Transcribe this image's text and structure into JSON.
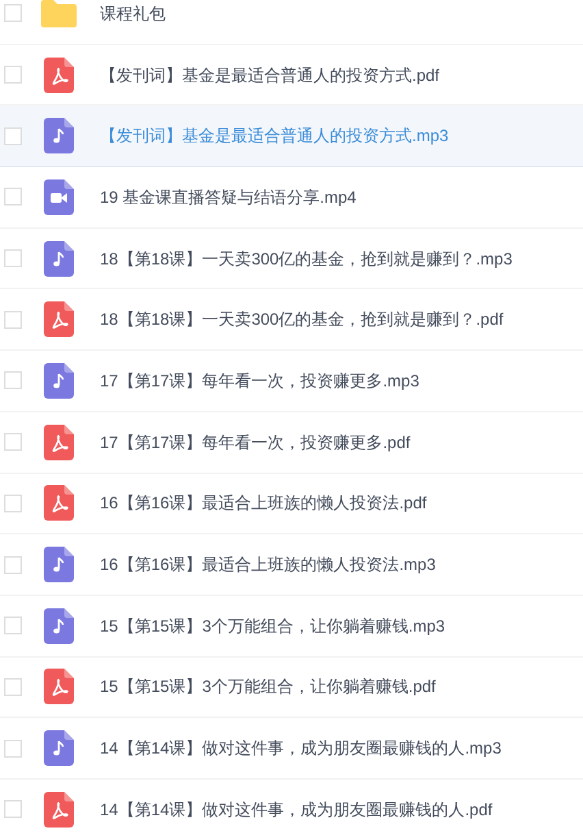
{
  "files": [
    {
      "kind": "folder",
      "name": "课程礼包",
      "selected": false,
      "checked": false
    },
    {
      "kind": "pdf",
      "name": "【发刊词】基金是最适合普通人的投资方式.pdf",
      "selected": false,
      "checked": false
    },
    {
      "kind": "audio",
      "name": "【发刊词】基金是最适合普通人的投资方式.mp3",
      "selected": true,
      "checked": false
    },
    {
      "kind": "video",
      "name": "19 基金课直播答疑与结语分享.mp4",
      "selected": false,
      "checked": false
    },
    {
      "kind": "audio",
      "name": "18【第18课】一天卖300亿的基金，抢到就是赚到？.mp3",
      "selected": false,
      "checked": false
    },
    {
      "kind": "pdf",
      "name": "18【第18课】一天卖300亿的基金，抢到就是赚到？.pdf",
      "selected": false,
      "checked": false
    },
    {
      "kind": "audio",
      "name": "17【第17课】每年看一次，投资赚更多.mp3",
      "selected": false,
      "checked": false
    },
    {
      "kind": "pdf",
      "name": "17【第17课】每年看一次，投资赚更多.pdf",
      "selected": false,
      "checked": false
    },
    {
      "kind": "pdf",
      "name": "16【第16课】最适合上班族的懒人投资法.pdf",
      "selected": false,
      "checked": false
    },
    {
      "kind": "audio",
      "name": "16【第16课】最适合上班族的懒人投资法.mp3",
      "selected": false,
      "checked": false
    },
    {
      "kind": "audio",
      "name": "15【第15课】3个万能组合，让你躺着赚钱.mp3",
      "selected": false,
      "checked": false
    },
    {
      "kind": "pdf",
      "name": "15【第15课】3个万能组合，让你躺着赚钱.pdf",
      "selected": false,
      "checked": false
    },
    {
      "kind": "audio",
      "name": "14【第14课】做对这件事，成为朋友圈最赚钱的人.mp3",
      "selected": false,
      "checked": false
    },
    {
      "kind": "pdf",
      "name": "14【第14课】做对这件事，成为朋友圈最赚钱的人.pdf",
      "selected": false,
      "checked": false
    }
  ]
}
